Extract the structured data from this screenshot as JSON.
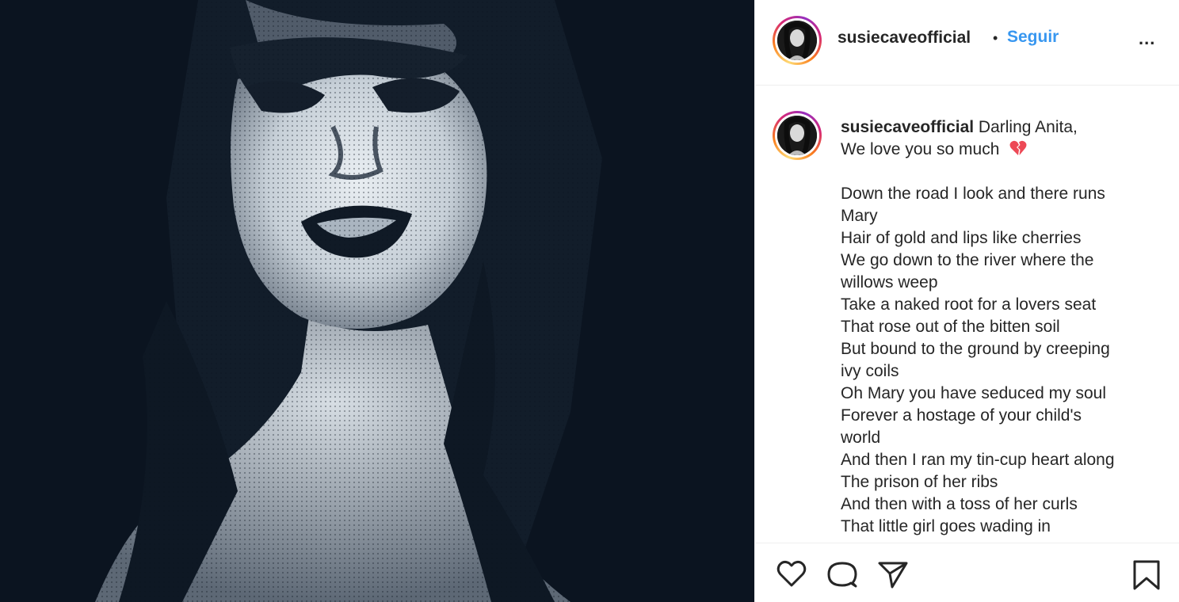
{
  "post": {
    "username": "susiecaveofficial",
    "separator": "•",
    "follow_label": "Seguir",
    "more_label": "..."
  },
  "caption": {
    "username": "susiecaveofficial",
    "first_line": " Darling Anita,",
    "second_line": "We love you so much",
    "emoji": "broken-heart-icon",
    "lyric_lines": [
      "Down the road I look and there runs",
      "Mary",
      "Hair of gold and lips like cherries",
      "We go down to the river where the",
      "willows weep",
      "Take a naked root for a lovers seat",
      "That rose out of the bitten soil",
      "But bound to the ground by creeping",
      "ivy coils",
      "Oh Mary you have seduced my soul",
      "Forever a hostage of your child's",
      "world",
      "And then I ran my tin-cup heart along",
      "The prison of her ribs",
      "And then with a toss of her curls",
      "That little girl goes wading in"
    ]
  },
  "actions": {
    "icons": [
      "heart-icon",
      "comment-icon",
      "share-icon",
      "bookmark-icon"
    ]
  },
  "colors": {
    "link_blue": "#3897f0",
    "text": "#262626",
    "photo_bg": "#0b1420",
    "broken_heart": "#ed4956"
  }
}
